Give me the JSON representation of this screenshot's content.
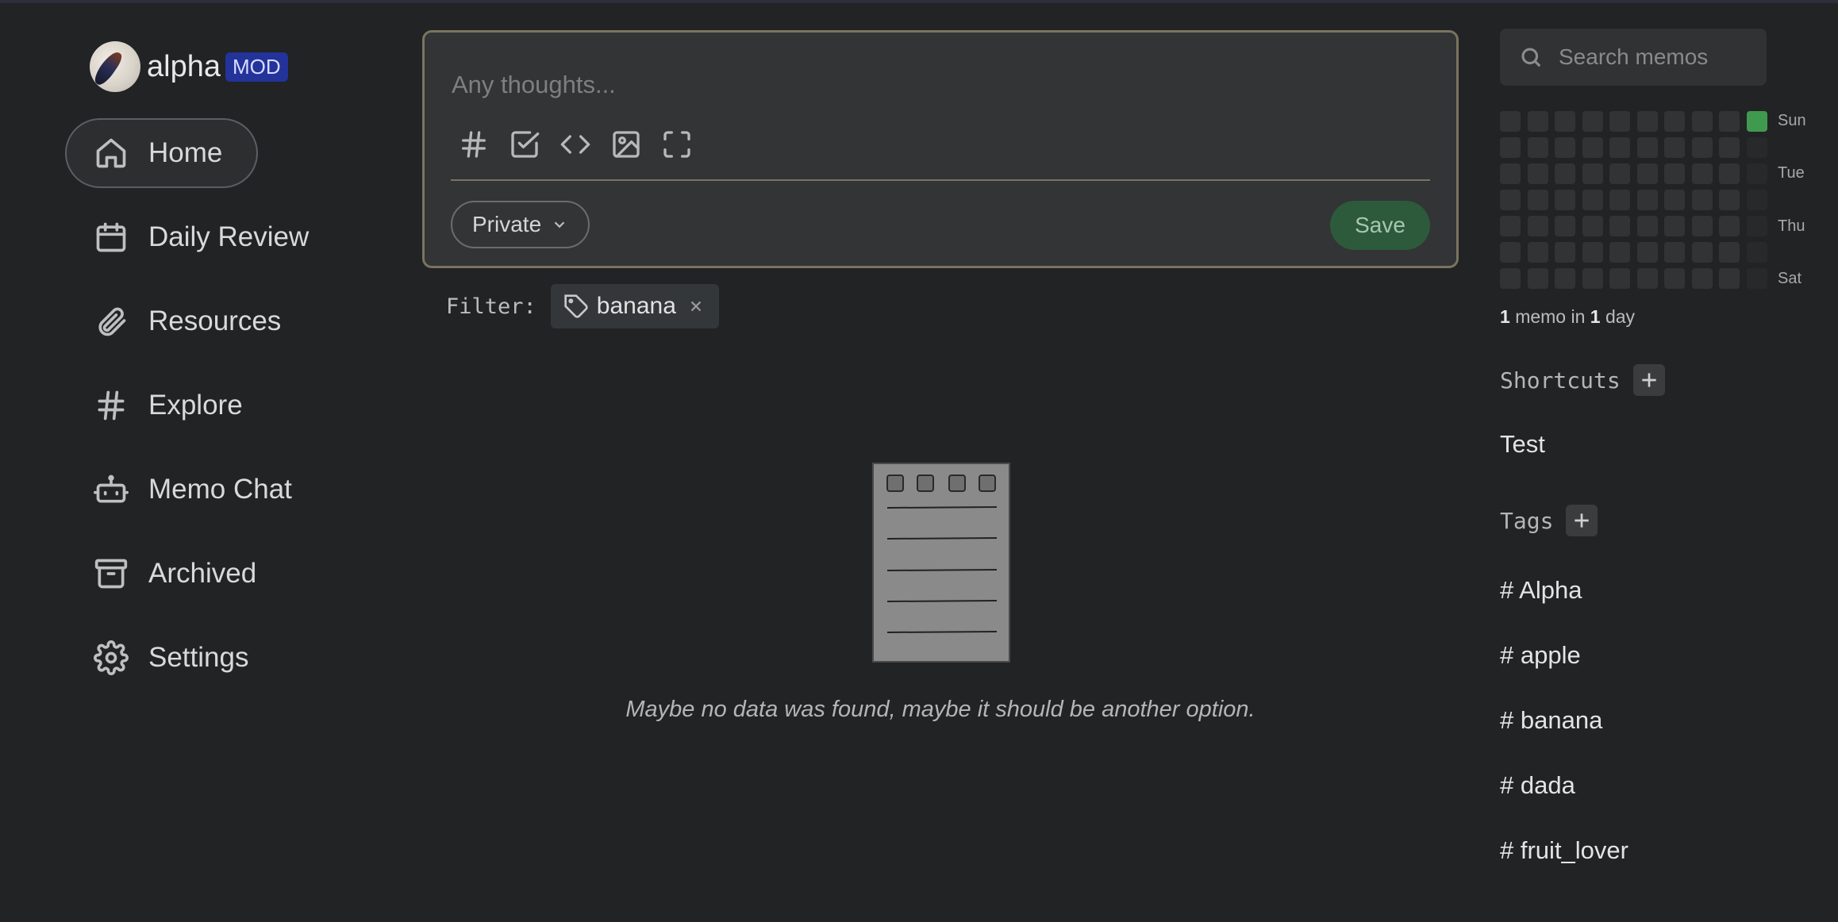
{
  "user": {
    "name": "alpha",
    "role_badge": "MOD"
  },
  "nav": [
    {
      "label": "Home",
      "icon": "home-icon",
      "active": true
    },
    {
      "label": "Daily Review",
      "icon": "calendar-icon"
    },
    {
      "label": "Resources",
      "icon": "paperclip-icon"
    },
    {
      "label": "Explore",
      "icon": "hash-icon"
    },
    {
      "label": "Memo Chat",
      "icon": "bot-icon"
    },
    {
      "label": "Archived",
      "icon": "archive-icon"
    },
    {
      "label": "Settings",
      "icon": "gear-icon"
    }
  ],
  "editor": {
    "placeholder": "Any thoughts...",
    "tools": [
      "hash-icon",
      "checkbox-icon",
      "code-icon",
      "image-icon",
      "fullscreen-icon"
    ],
    "visibility": "Private",
    "save_label": "Save"
  },
  "filter": {
    "label": "Filter:",
    "tag": "banana"
  },
  "empty_state": {
    "message": "Maybe no data was found, maybe it should be another option."
  },
  "search": {
    "placeholder": "Search memos"
  },
  "heatmap": {
    "day_labels": [
      "Sun",
      "Tue",
      "Thu",
      "Sat"
    ],
    "stats": {
      "memo_count": "1",
      "memo_text": "memo in",
      "day_count": "1",
      "day_text": "day"
    },
    "active_color": "#3f9a50"
  },
  "shortcuts": {
    "title": "Shortcuts",
    "items": [
      "Test"
    ]
  },
  "tags": {
    "title": "Tags",
    "items": [
      "Alpha",
      "apple",
      "banana",
      "dada",
      "fruit_lover"
    ],
    "prefix": "#"
  },
  "colors": {
    "background": "#212325",
    "editor_border": "#7a7460",
    "mod_badge": "#23339a",
    "save_button": "#2c5a3a"
  }
}
